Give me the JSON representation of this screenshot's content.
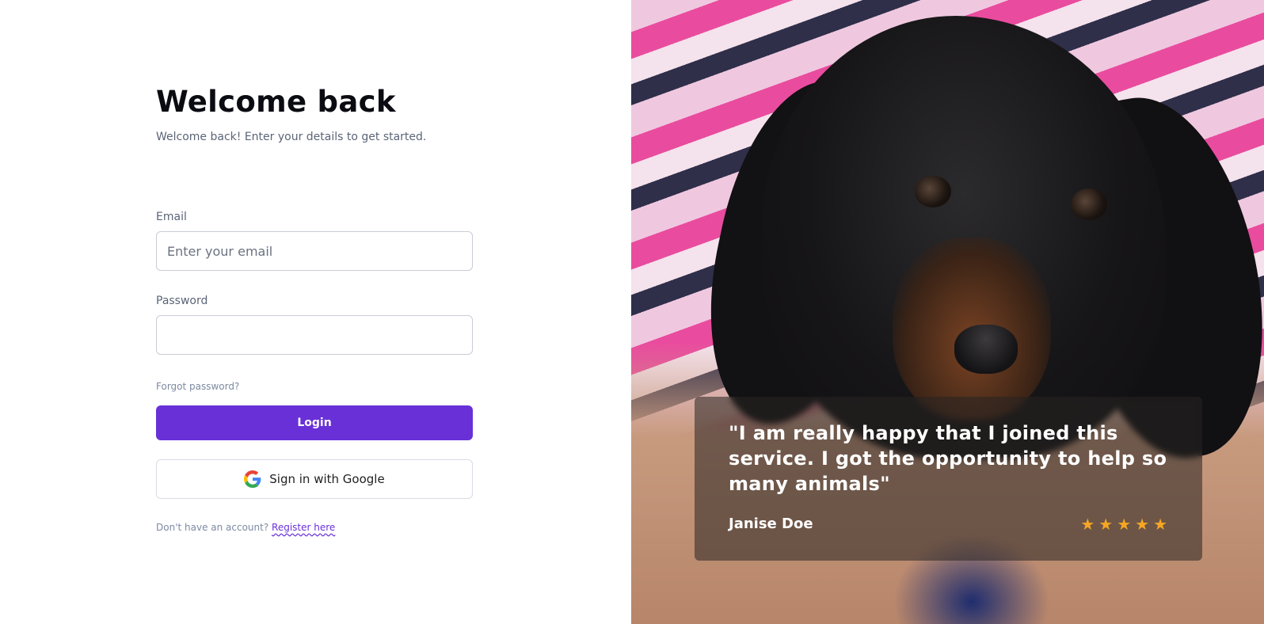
{
  "login": {
    "title": "Welcome back",
    "subtitle": "Welcome back! Enter your details to get started.",
    "email_label": "Email",
    "email_placeholder": "Enter your email",
    "email_value": "",
    "password_label": "Password",
    "password_value": "",
    "forgot_password": "Forgot password?",
    "login_button": "Login",
    "google_button": "Sign in with Google",
    "google_icon": "google-g-icon",
    "no_account_text": "Don't have an account?",
    "register_link": "Register here"
  },
  "testimonial": {
    "quote": "\"I am really happy that I joined this service. I got the opportunity to help so many animals\"",
    "author": "Janise Doe",
    "rating": 5,
    "rating_max": 5,
    "star_glyph": "★",
    "star_color": "#f5a623"
  },
  "hero_image": {
    "subject": "dachshund puppy photo"
  },
  "colors": {
    "accent": "#6930d8",
    "text_muted": "#5b6577",
    "border": "#c9ccd6"
  }
}
